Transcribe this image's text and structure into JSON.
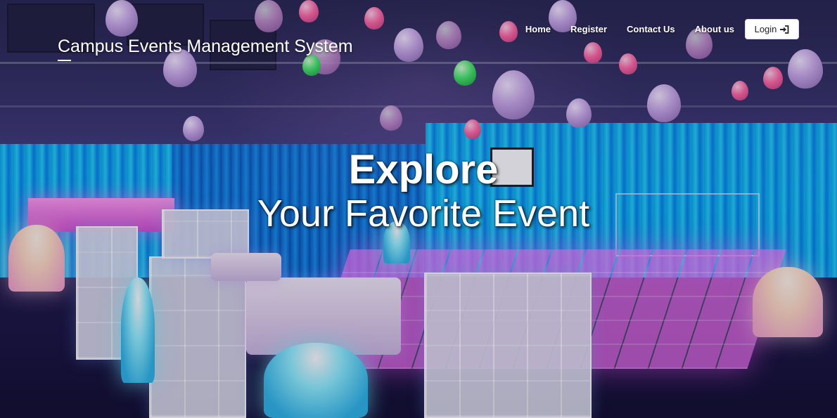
{
  "app": {
    "brand": "Campus Events Management System"
  },
  "nav": {
    "items": [
      {
        "label": "Home"
      },
      {
        "label": "Register"
      },
      {
        "label": "Contact Us"
      },
      {
        "label": "About us"
      }
    ],
    "login_label": "Login",
    "login_icon": "sign-in-icon"
  },
  "hero": {
    "line1": "Explore",
    "line2": "Your Favorite Event",
    "background": "event-hall-photo"
  },
  "colors": {
    "curtain": "#2fb6ff",
    "glow_pink": "#ff6fe8",
    "text": "#ffffff"
  }
}
